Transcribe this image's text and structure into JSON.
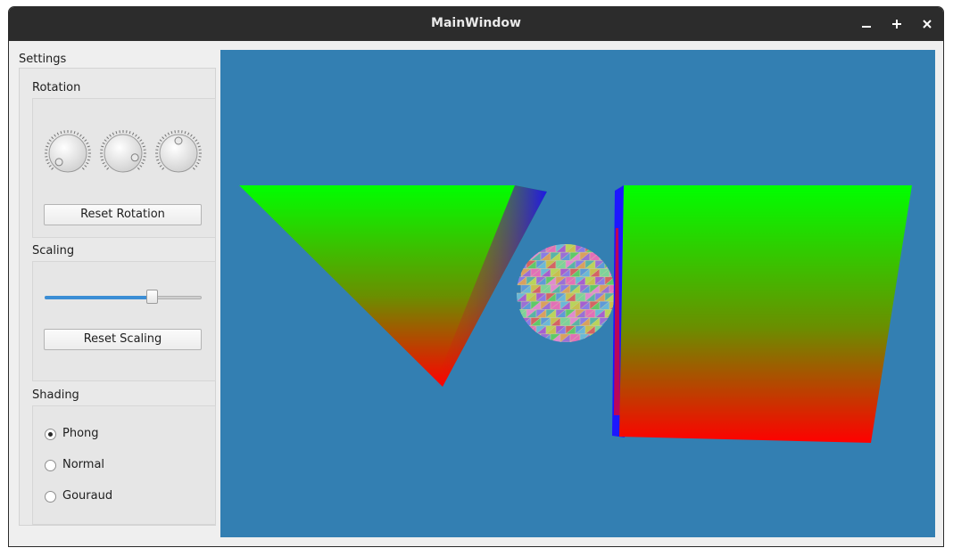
{
  "window": {
    "title": "MainWindow"
  },
  "settings": {
    "title": "Settings",
    "rotation": {
      "title": "Rotation",
      "reset_label": "Reset Rotation",
      "dials": [
        {
          "name": "rotation-x-dial",
          "marker_angle_deg": 225
        },
        {
          "name": "rotation-y-dial",
          "marker_angle_deg": 110
        },
        {
          "name": "rotation-z-dial",
          "marker_angle_deg": 0
        }
      ]
    },
    "scaling": {
      "title": "Scaling",
      "reset_label": "Reset Scaling",
      "slider_fraction": 0.7
    },
    "shading": {
      "title": "Shading",
      "options": [
        {
          "label": "Phong",
          "checked": true
        },
        {
          "label": "Normal",
          "checked": false
        },
        {
          "label": "Gouraud",
          "checked": false
        }
      ]
    }
  },
  "scene": {
    "background_color": "#337fb2",
    "objects": [
      "pyramid",
      "sphere",
      "cube"
    ]
  },
  "colors": {
    "titlebar": "#2c2c2c",
    "accent": "#3b8ed5"
  }
}
